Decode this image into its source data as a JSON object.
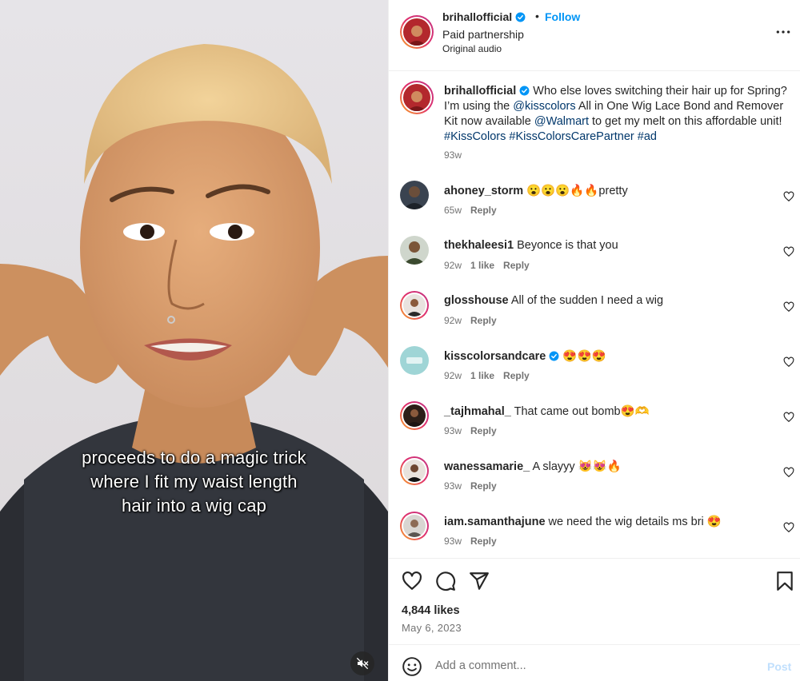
{
  "post": {
    "username": "brihallofficial",
    "follow_label": "Follow",
    "separator": "•",
    "sponsor_text": "Paid partnership",
    "audio_text": "Original audio",
    "more_icon": "more-horizontal-icon"
  },
  "video": {
    "overlay_lines": [
      "proceeds to do a magic trick",
      "where I fit my waist length",
      "hair into a wig cap"
    ],
    "mute_icon": "muted-speaker-icon"
  },
  "caption": {
    "username": "brihallofficial",
    "text_1": "Who else loves switching their hair up for Spring? I’m using the ",
    "mention_1": "@kisscolors",
    "text_2": " All in One Wig Lace Bond and Remover Kit now available ",
    "mention_2": "@Walmart",
    "text_3": " to get my melt on this affordable unit! ",
    "hashtags": "#KissColors #KissColorsCarePartner #ad",
    "time": "93w"
  },
  "comments": [
    {
      "username": "ahoney_storm",
      "text": "😮😮😮🔥🔥pretty",
      "time": "65w",
      "likes": "",
      "reply": "Reply"
    },
    {
      "username": "thekhaleesi1",
      "text": "Beyonce is that you",
      "time": "92w",
      "likes": "1 like",
      "reply": "Reply"
    },
    {
      "username": "glosshouse",
      "text": "All of the sudden I need a wig",
      "time": "92w",
      "likes": "",
      "reply": "Reply"
    },
    {
      "username": "kisscolorsandcare",
      "text": "😍😍😍",
      "time": "92w",
      "likes": "1 like",
      "reply": "Reply"
    },
    {
      "username": "_tajhmahal_",
      "text": "That came out bomb😍🫶",
      "time": "93w",
      "likes": "",
      "reply": "Reply"
    },
    {
      "username": "wanessamarie_",
      "text": "A slayyy 😻😻🔥",
      "time": "93w",
      "likes": "",
      "reply": "Reply"
    },
    {
      "username": "iam.samanthajune",
      "text": "we need the wig details ms bri 😍",
      "time": "93w",
      "likes": "",
      "reply": "Reply"
    }
  ],
  "actions": {
    "likes": "4,844 likes",
    "date": "May 6, 2023",
    "icons": [
      "heart-icon",
      "comment-icon",
      "share-icon",
      "bookmark-icon"
    ]
  },
  "composer": {
    "placeholder": "Add a comment...",
    "post_label": "Post"
  },
  "colors": {
    "link_blue": "#0095f6",
    "mention_blue": "#00376b",
    "muted_text": "#737373",
    "post_disabled": "#c0dffd"
  }
}
